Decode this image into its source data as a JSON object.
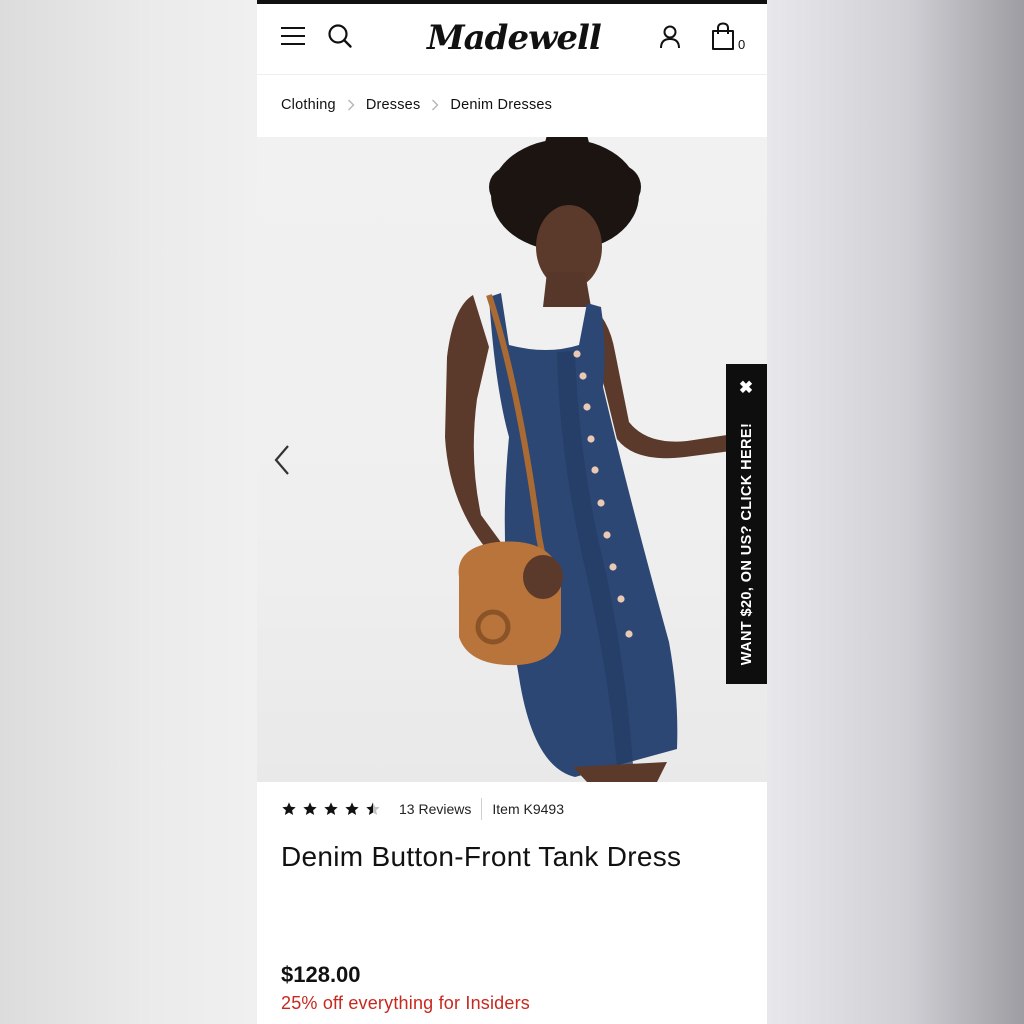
{
  "header": {
    "logo_text": "Madewell",
    "bag_count": "0"
  },
  "breadcrumb": [
    "Clothing",
    "Dresses",
    "Denim Dresses"
  ],
  "hero": {
    "image_description": "Model wearing denim button-front tank dress with tan leather crossbody bag"
  },
  "promo_tab": {
    "text": "WANT $20, ON US? CLICK HERE!",
    "close_icon": "close-icon"
  },
  "product": {
    "rating": 4.5,
    "rating_max": 5,
    "reviews_label": "13 Reviews",
    "item_label": "Item K9493",
    "title": "Denim Button-Front Tank Dress",
    "price": "$128.00",
    "promo": "25% off everything for Insiders"
  },
  "colors": {
    "accent_red": "#c8281e",
    "promo_bg": "#0e0e0e",
    "denim": "#2c4774",
    "bag_tan": "#b8743a"
  }
}
